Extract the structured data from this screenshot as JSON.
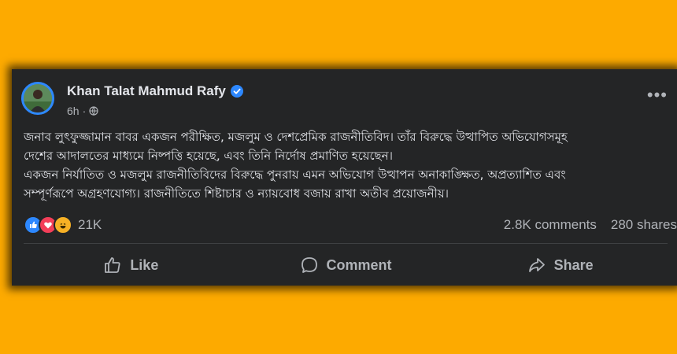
{
  "post": {
    "author": "Khan Talat Mahmud Rafy",
    "time": "6h",
    "privacy_icon": "globe-icon",
    "verified_icon": "verified-badge-icon",
    "body_lines": [
      "জনাব লুৎফুজ্জামান বাবর একজন পরীক্ষিত, মজলুম ও দেশপ্রেমিক রাজনীতিবিদ। তাঁর বিরুদ্ধে উত্থাপিত অভিযোগসমূহ",
      "দেশের আদালতের মাধ্যমে নিষ্পত্তি হয়েছে, এবং তিনি নির্দোষ প্রমাণিত হয়েছেন।",
      "একজন নির্যাতিত ও মজলুম রাজনীতিবিদের বিরুদ্ধে পুনরায় এমন অভিযোগ উত্থাপন অনাকাঙ্ক্ষিত, অপ্রত্যাশিত এবং",
      "সম্পূর্ণরূপে অগ্রহণযোগ্য। রাজনীতিতে শিষ্টাচার ও ন্যায়বোধ বজায় রাখা অতীব প্রয়োজনীয়।"
    ],
    "reactions": {
      "icons": [
        "like-reaction-icon",
        "love-reaction-icon",
        "haha-reaction-icon"
      ],
      "count": "21K"
    },
    "comments": "2.8K comments",
    "shares": "280 shares"
  },
  "actions": {
    "like": "Like",
    "comment": "Comment",
    "share": "Share"
  },
  "colors": {
    "background": "#FDAA00",
    "card": "#242526",
    "text": "#E4E6EB",
    "muted": "#B0B3B8",
    "accent": "#2D88FF"
  }
}
